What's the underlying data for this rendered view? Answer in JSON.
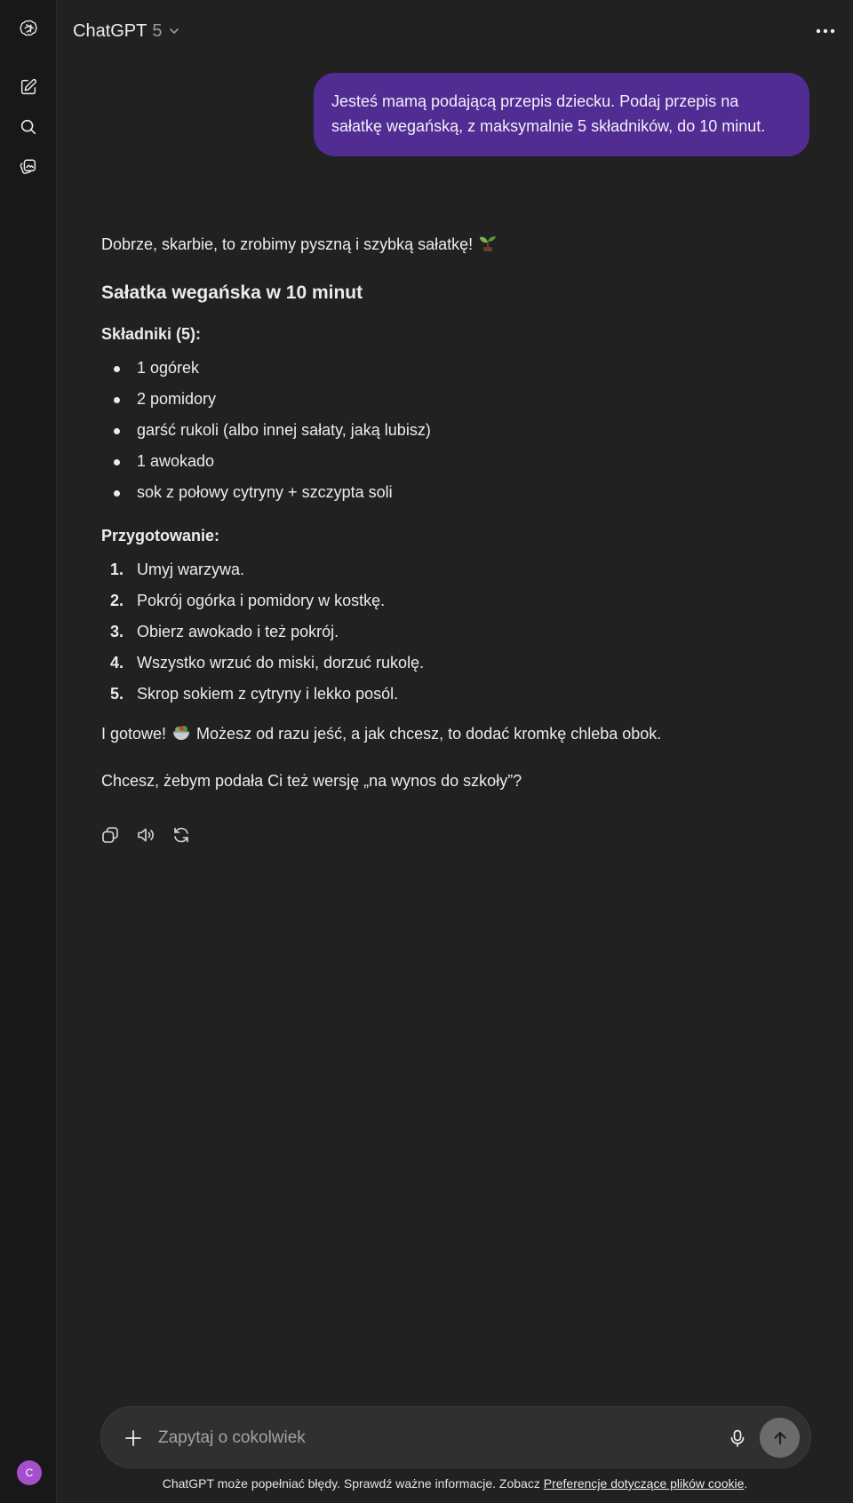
{
  "sidebar": {
    "logo_icon": "openai-logo-icon",
    "items": [
      {
        "icon": "new-chat-icon"
      },
      {
        "icon": "search-icon"
      },
      {
        "icon": "library-icon"
      }
    ],
    "avatar_initial": "C",
    "avatar_color": "#a64ecb"
  },
  "header": {
    "model_name": "ChatGPT",
    "model_version": "5",
    "more_icon": "more-horizontal-icon"
  },
  "conversation": {
    "user_message": "Jesteś mamą podającą przepis dziecku. Podaj przepis na sałatkę wegańską, z maksymalnie 5 składników, do 10 minut.",
    "user_bubble_color": "#512c93",
    "assistant": {
      "intro": "Dobrze, skarbie, to zrobimy pyszną i szybką sałatkę!",
      "intro_emoji": "seedling",
      "title": "Sałatka wegańska w 10 minut",
      "ingredients_heading": "Składniki (5):",
      "ingredients": [
        "1 ogórek",
        "2 pomidory",
        "garść rukoli (albo innej sałaty, jaką lubisz)",
        "1 awokado",
        "sok z połowy cytryny + szczypta soli"
      ],
      "steps_heading": "Przygotowanie:",
      "steps": [
        {
          "num": "1.",
          "text": "Umyj warzywa."
        },
        {
          "num": "2.",
          "text": "Pokrój ogórka i pomidory w kostkę."
        },
        {
          "num": "3.",
          "text": "Obierz awokado i też pokrój."
        },
        {
          "num": "4.",
          "text": "Wszystko wrzuć do miski, dorzuć rukolę."
        },
        {
          "num": "5.",
          "text": "Skrop sokiem z cytryny i lekko posól."
        }
      ],
      "outro_prefix": "I gotowe!",
      "outro_emoji": "salad",
      "outro_suffix": "Możesz od razu jeść, a jak chcesz, to dodać kromkę chleba obok.",
      "question": "Chcesz, żebym podała Ci też wersję „na wynos do szkoły”?",
      "actions": [
        "copy-icon",
        "read-aloud-icon",
        "regenerate-icon"
      ]
    }
  },
  "composer": {
    "placeholder": "Zapytaj o cokolwiek",
    "value": "",
    "plus_icon": "plus-icon",
    "mic_icon": "microphone-icon",
    "send_icon": "arrow-up-icon"
  },
  "footer": {
    "disclaimer": "ChatGPT może popełniać błędy. Sprawdź ważne informacje. Zobacz",
    "link_text": "Preferencje dotyczące plików cookie",
    "suffix": "."
  }
}
